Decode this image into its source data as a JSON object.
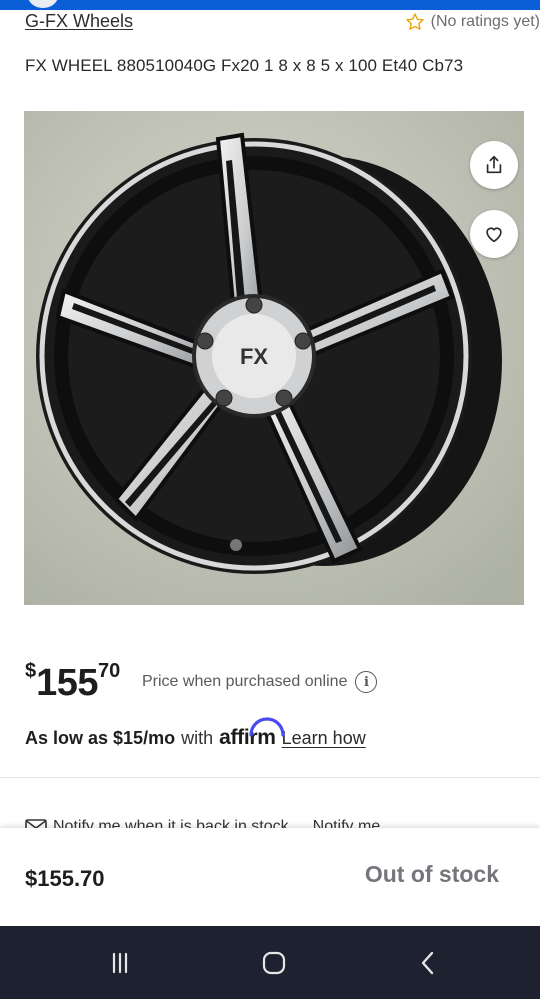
{
  "status": {
    "accent_color": "#0a5fd6"
  },
  "header": {
    "brand": "G-FX Wheels",
    "rating_icon": "star-outline-icon",
    "rating_text": "(No ratings yet)"
  },
  "product": {
    "title": "FX WHEEL 880510040G Fx20 1 8 x 8 5 x 100 Et40 Cb73",
    "image_subject": "black machined five-spoke alloy wheel",
    "image_hub_text": "FX",
    "actions": {
      "share_icon": "share-icon",
      "favorite_icon": "heart-icon"
    }
  },
  "pricing": {
    "currency_symbol": "$",
    "whole": "155",
    "cents": "70",
    "note": "Price when purchased online",
    "info_icon": "info-icon",
    "info_glyph": "i"
  },
  "financing": {
    "prefix": "As low as $15/mo",
    "connector": "with",
    "provider": "affirm",
    "link": "Learn how"
  },
  "notify": {
    "icon": "mail-icon",
    "text": "Notify me when it is back in stock",
    "text_secondary": "Notify me"
  },
  "bottom_bar": {
    "price": "$155.70",
    "status": "Out of stock",
    "status_color": "#74767c"
  },
  "navigation": {
    "recent_icon": "recent-apps-icon",
    "home_icon": "home-icon",
    "back_icon": "back-icon"
  }
}
